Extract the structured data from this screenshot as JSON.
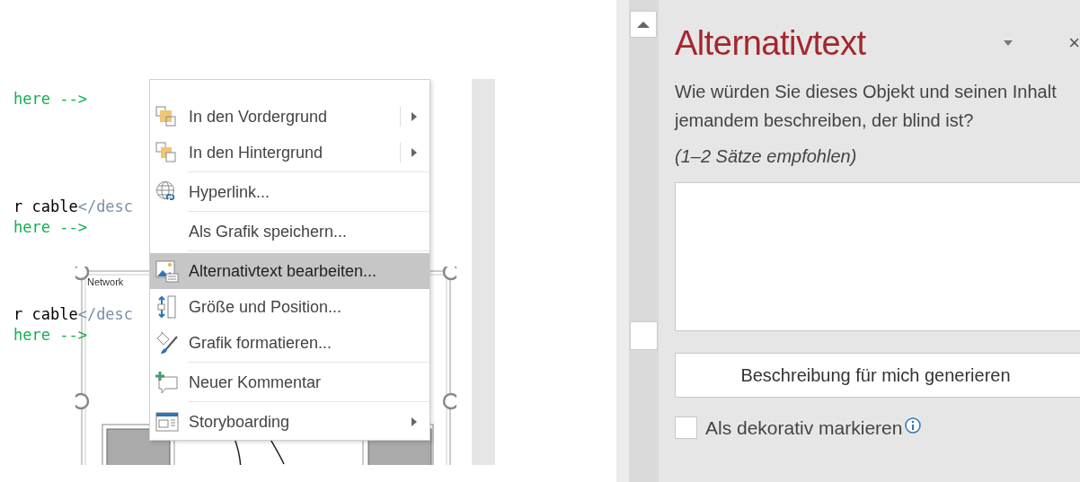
{
  "editor": {
    "code_groups": [
      {
        "lines": [
          {
            "kind": "comment",
            "text": "here -->"
          }
        ]
      },
      {
        "lines": [
          {
            "kind": "markup",
            "text": "r cable",
            "tag": "</desc"
          },
          {
            "kind": "comment",
            "text": "here -->"
          }
        ]
      },
      {
        "lines": [
          {
            "kind": "markup",
            "text": "r cable",
            "tag": "</desc"
          },
          {
            "kind": "comment",
            "text": "here -->"
          }
        ]
      }
    ],
    "image": {
      "label": "Network",
      "selected": true
    }
  },
  "context_menu": {
    "items": [
      {
        "kind": "item",
        "label": "In den Vordergrund",
        "disabled": false,
        "selected": false,
        "submenu": true,
        "split": true
      },
      {
        "kind": "item",
        "label": "In den Hintergrund",
        "disabled": false,
        "selected": false,
        "submenu": true,
        "split": true
      },
      {
        "kind": "separator"
      },
      {
        "kind": "item",
        "label": "Hyperlink...",
        "disabled": false,
        "selected": false,
        "submenu": false,
        "split": false
      },
      {
        "kind": "separator"
      },
      {
        "kind": "item",
        "label": "Als Grafik speichern...",
        "disabled": false,
        "selected": false,
        "submenu": false,
        "split": false
      },
      {
        "kind": "separator"
      },
      {
        "kind": "item",
        "label": "Alternativtext bearbeiten...",
        "disabled": false,
        "selected": true,
        "submenu": false,
        "split": false
      },
      {
        "kind": "item",
        "label": "Größe und Position...",
        "disabled": false,
        "selected": false,
        "submenu": false,
        "split": false
      },
      {
        "kind": "item",
        "label": "Grafik formatieren...",
        "disabled": false,
        "selected": false,
        "submenu": false,
        "split": false
      },
      {
        "kind": "separator"
      },
      {
        "kind": "item",
        "label": "Neuer Kommentar",
        "disabled": false,
        "selected": false,
        "submenu": false,
        "split": false
      },
      {
        "kind": "separator"
      },
      {
        "kind": "item",
        "label": "Storyboarding",
        "disabled": false,
        "selected": false,
        "submenu": true,
        "split": false
      }
    ]
  },
  "pane": {
    "title": "Alternativtext",
    "close": "×",
    "question": "Wie würden Sie dieses Objekt und seinen Inhalt jemandem beschreiben, der blind ist?",
    "hint": "(1–2 Sätze empfohlen)",
    "generate_button": "Beschreibung für mich generieren",
    "decorative": {
      "label": "Als dekorativ markieren",
      "checked": false
    }
  }
}
